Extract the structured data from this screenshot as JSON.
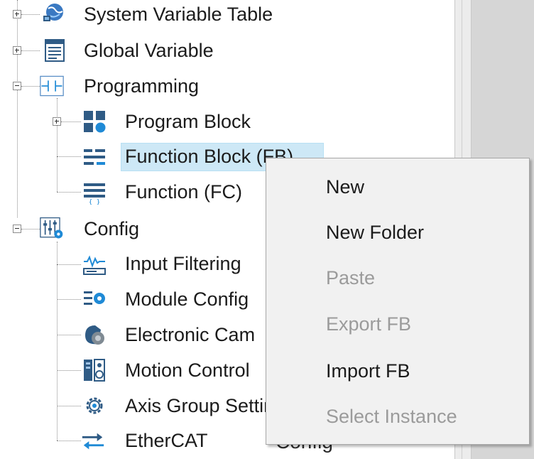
{
  "tree": {
    "items": [
      {
        "label": "System Variable Table",
        "icon": "globe-network-icon"
      },
      {
        "label": "Global Variable",
        "icon": "variable-table-icon"
      },
      {
        "label": "Programming",
        "icon": "ladder-contact-icon"
      },
      {
        "label": "Program Block",
        "icon": "program-block-icon"
      },
      {
        "label": "Function Block (FB)",
        "icon": "function-block-icon"
      },
      {
        "label": "Function (FC)",
        "icon": "function-icon"
      },
      {
        "label": "Config",
        "icon": "config-sliders-icon"
      },
      {
        "label": "Input Filtering",
        "icon": "input-filter-icon"
      },
      {
        "label": "Module Config",
        "icon": "module-config-icon"
      },
      {
        "label": "Electronic Cam",
        "icon": "electronic-cam-icon"
      },
      {
        "label": "Motion Control",
        "icon": "motion-control-icon"
      },
      {
        "label": "Axis Group Setting",
        "icon": "axis-group-gear-icon"
      },
      {
        "label": "EtherCAT",
        "icon": "ethercat-arrows-icon"
      }
    ],
    "behind_menu_text": "Config"
  },
  "context_menu": {
    "items": [
      {
        "label": "New",
        "enabled": true
      },
      {
        "label": "New Folder",
        "enabled": true
      },
      {
        "label": "Paste",
        "enabled": false
      },
      {
        "label": "Export FB",
        "enabled": false
      },
      {
        "label": "Import FB",
        "enabled": true
      },
      {
        "label": "Select Instance",
        "enabled": false
      }
    ]
  },
  "colors": {
    "selection": "#cde8f6",
    "icon_blue": "#2f5b85",
    "icon_accent": "#1f8ad6",
    "disabled_text": "#9b9b9b"
  }
}
